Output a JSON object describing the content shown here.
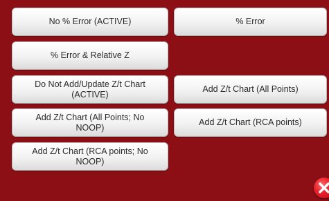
{
  "buttons": {
    "no_error": "No % Error (ACTIVE)",
    "error": "% Error",
    "error_rel_z": "% Error & Relative Z",
    "do_not_add": "Do Not Add/Update Z/t Chart\n(ACTIVE)",
    "add_all": "Add Z/t Chart (All Points)",
    "add_all_no_noop": "Add Z/t Chart (All Points; No\nNOOP)",
    "add_rca": "Add Z/t Chart (RCA points)",
    "add_rca_no_noop": "Add Z/t Chart (RCA points; No\nNOOP)"
  },
  "close": {
    "icon": "close-icon"
  },
  "colors": {
    "background": "#8b0f14",
    "close_button": "#e8202a"
  }
}
